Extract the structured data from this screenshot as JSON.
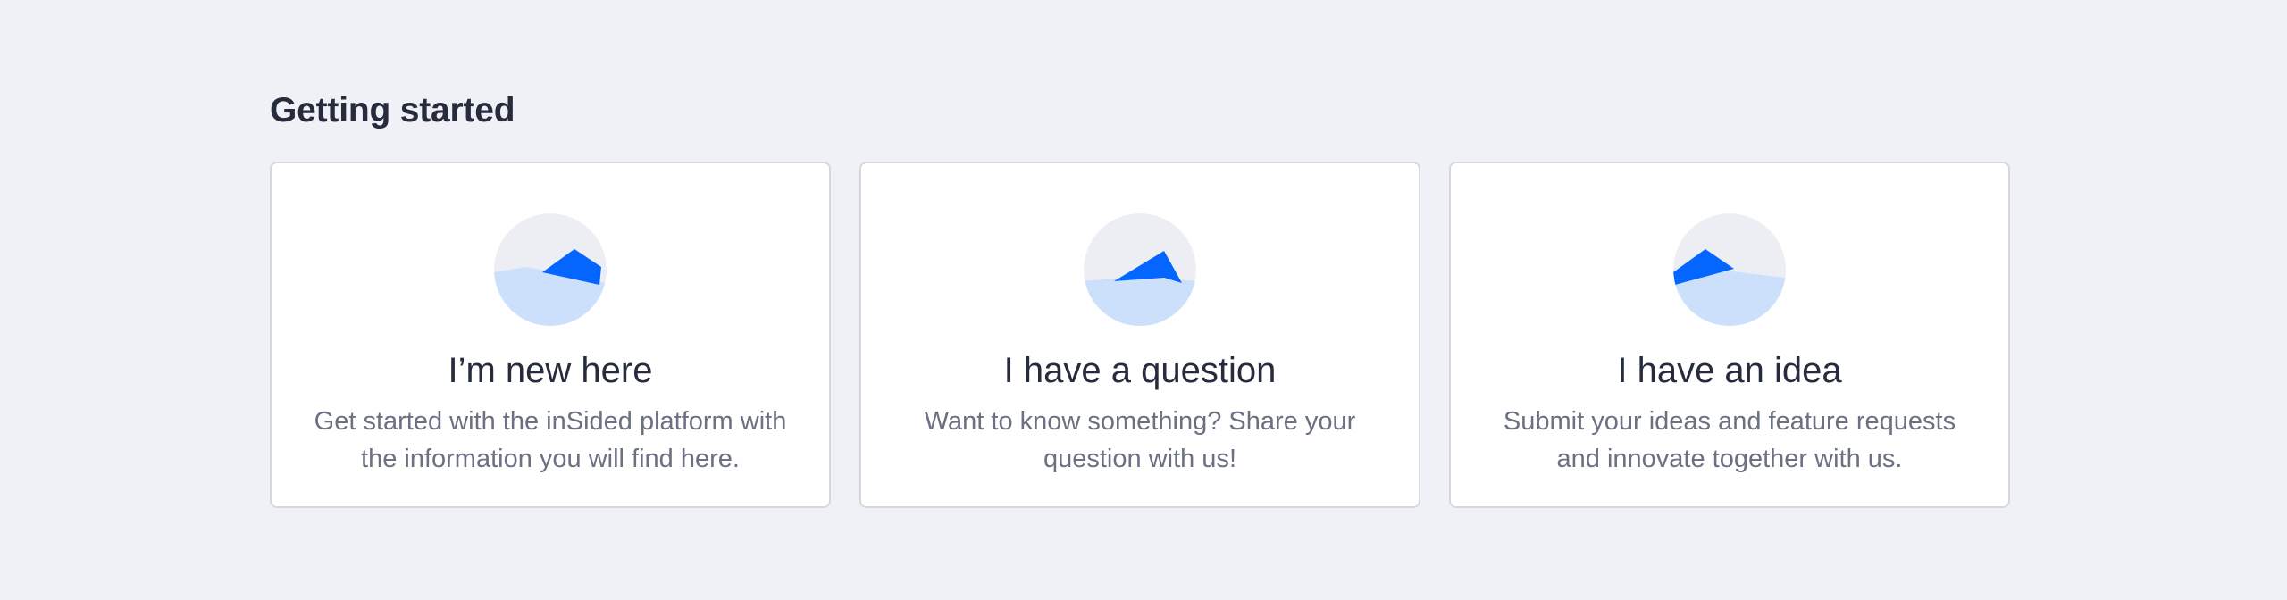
{
  "section": {
    "title": "Getting started"
  },
  "cards": [
    {
      "title": "I’m new here",
      "description": "Get started with the inSided platform with the information you will find here.",
      "icon": "mountain-illustration-icon"
    },
    {
      "title": "I have a question",
      "description": "Want to know something? Share your question with us!",
      "icon": "mountain-illustration-icon"
    },
    {
      "title": "I have an idea",
      "description": "Submit your ideas and feature requests and innovate together with us.",
      "icon": "mountain-illustration-icon"
    }
  ],
  "colors": {
    "page_background": "#f0f1f6",
    "card_background": "#ffffff",
    "card_border": "#d6d8df",
    "heading": "#262c3d",
    "body_text": "#6b7082",
    "accent_blue": "#0566ff",
    "light_blue": "#cce0fc",
    "circle_gray": "#eceef4"
  }
}
